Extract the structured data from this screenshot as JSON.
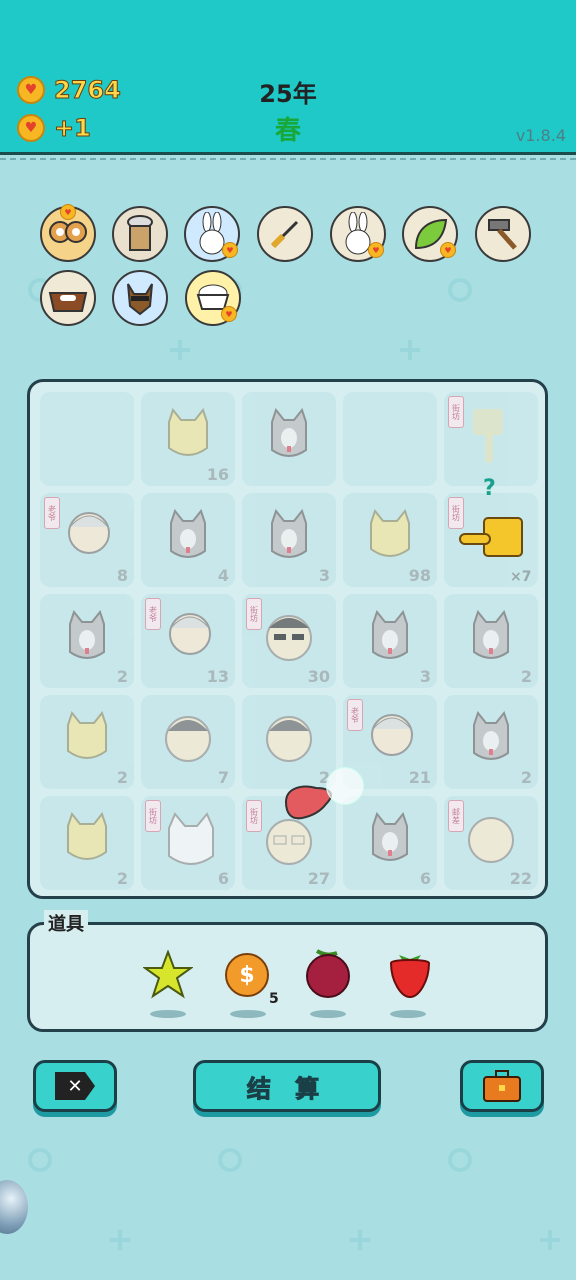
{
  "header": {
    "coins": "2764",
    "income": "+1",
    "year": "25年",
    "season": "春",
    "version": "v1.8.4"
  },
  "icons": [
    {
      "name": "owl-pair-icon",
      "coin": true
    },
    {
      "name": "bubble-tea-icon",
      "coin": false
    },
    {
      "name": "rabbit-icon",
      "coin": true
    },
    {
      "name": "screwdriver-icon",
      "coin": false
    },
    {
      "name": "rabbit-icon",
      "coin": true
    },
    {
      "name": "leaf-icon",
      "coin": true
    },
    {
      "name": "hammer-icon",
      "coin": false
    },
    {
      "name": "dog-food-bowl-icon",
      "coin": false
    },
    {
      "name": "shiba-dog-icon",
      "coin": false
    },
    {
      "name": "rice-bowl-icon",
      "coin": true
    }
  ],
  "board": {
    "cells": [
      {
        "label": "",
        "kind": "empty"
      },
      {
        "label": "16",
        "kind": "cat"
      },
      {
        "label": "",
        "kind": "husky"
      },
      {
        "label": "",
        "kind": "empty"
      },
      {
        "label": "",
        "kind": "hand-down",
        "tag": "街坊"
      },
      {
        "label": "8",
        "kind": "oldman",
        "tag": "老爷"
      },
      {
        "label": "4",
        "kind": "husky"
      },
      {
        "label": "3",
        "kind": "husky"
      },
      {
        "label": "98",
        "kind": "cat"
      },
      {
        "label": "",
        "kind": "hand-left",
        "tag": "街坊"
      },
      {
        "label": "2",
        "kind": "husky"
      },
      {
        "label": "13",
        "kind": "oldman",
        "tag": "老爷"
      },
      {
        "label": "30",
        "kind": "sunglass",
        "tag": "街坊"
      },
      {
        "label": "3",
        "kind": "husky"
      },
      {
        "label": "2",
        "kind": "husky"
      },
      {
        "label": "2",
        "kind": "cat"
      },
      {
        "label": "7",
        "kind": "face"
      },
      {
        "label": "2",
        "kind": "face"
      },
      {
        "label": "21",
        "kind": "oldman",
        "tag": "老爷"
      },
      {
        "label": "2",
        "kind": "husky"
      },
      {
        "label": "2",
        "kind": "cat"
      },
      {
        "label": "6",
        "kind": "samoyed",
        "tag": "街坊"
      },
      {
        "label": "27",
        "kind": "grandpa",
        "tag": "街坊"
      },
      {
        "label": "6",
        "kind": "husky"
      },
      {
        "label": "22",
        "kind": "bald",
        "tag": "邮差"
      }
    ],
    "question": "?",
    "multiplier": "×7"
  },
  "props": {
    "label": "道具",
    "items": [
      {
        "name": "star-item",
        "count": ""
      },
      {
        "name": "coin-item",
        "count": "5"
      },
      {
        "name": "bayberry-item",
        "count": ""
      },
      {
        "name": "strawberry-item",
        "count": ""
      }
    ]
  },
  "buttons": {
    "settle": "结 算"
  },
  "colors": {
    "header": "#1ec9c8",
    "background": "#a9dfe3",
    "accent_yellow": "#ffd84a",
    "season_green": "#18a83a"
  }
}
